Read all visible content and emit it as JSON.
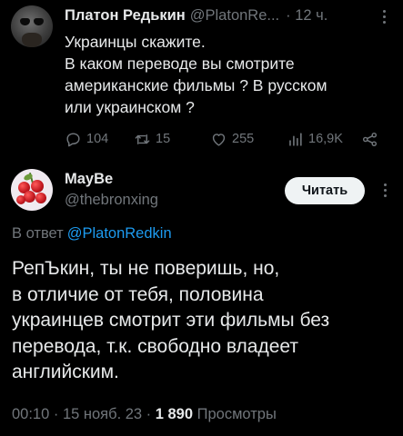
{
  "parent_tweet": {
    "author_name": "Платон Редькин",
    "handle": "@PlatonRe...",
    "time": "· 12 ч.",
    "text_lines": [
      "Украинцы скажите.",
      "В каком переводе вы смотрите",
      "американские фильмы ? В русском",
      "или украинском ?"
    ],
    "reply_count": "104",
    "retweet_count": "15",
    "like_count": "255",
    "view_count": "16,9K",
    "icons": [
      "reply-icon",
      "retweet-icon",
      "like-icon",
      "views-icon",
      "share-icon",
      "more-icon"
    ]
  },
  "reply_tweet": {
    "author_name": "MayBe",
    "handle": "@thebronxing",
    "follow_label": "Читать",
    "reply_to_label": "В ответ",
    "reply_to_mention": "@PlatonRedkin",
    "text_lines": [
      "РепЪкин, ты не поверишь, но,",
      "в отличие от тебя,  половина",
      "украинцев смотрит эти фильмы без",
      "перевода, т.к. свободно владеет",
      "английским."
    ],
    "timestamp": "00:10 · 15 нояб. 23 · ",
    "views_count": "1 890",
    "views_label": " Просмотры"
  },
  "colors": {
    "background": "#000000",
    "text_primary": "#e7e9ea",
    "text_secondary": "#71767b",
    "link": "#1d9bf0",
    "button_bg": "#eff3f4"
  }
}
